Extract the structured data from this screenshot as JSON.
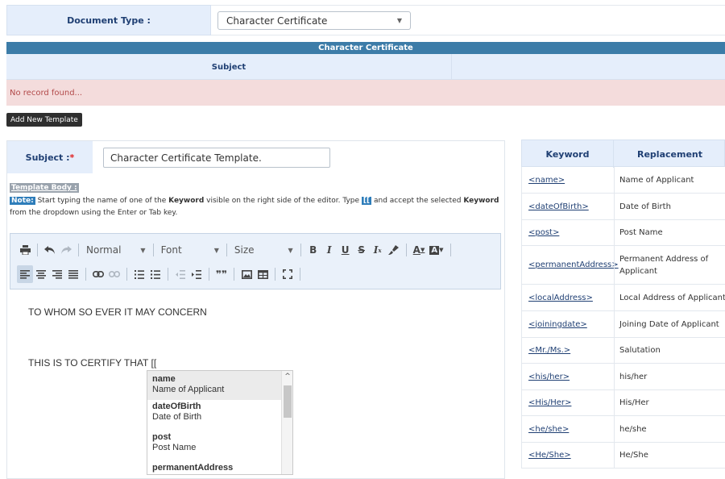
{
  "document_type": {
    "label": "Document Type :",
    "selected": "Character Certificate"
  },
  "templates_table": {
    "title": "Character Certificate",
    "column_subject": "Subject",
    "empty_message": "No record found...",
    "add_button": "Add New Template"
  },
  "editor": {
    "subject_label": "Subject :",
    "subject_required": "*",
    "subject_value": "Character Certificate Template.",
    "template_body_label": "Template Body :",
    "note_badge": "Note:",
    "note_part1": " Start typing the name of one of the ",
    "note_keyword_bold": "Keyword",
    "note_part2": " visible on the right side of the editor. Type ",
    "note_bracket": "[[",
    "note_part3": " and accept the selected ",
    "note_keyword_bold2": "Keyword",
    "note_part4": " from the dropdown using the Enter or Tab key.",
    "toolbar": {
      "format": "Normal",
      "font": "Font",
      "size": "Size"
    },
    "content_line1": "TO WHOM SO EVER IT MAY CONCERN",
    "content_line2": "THIS IS TO CERTIFY THAT [[",
    "autocomplete": [
      {
        "keyword": "name",
        "description": "Name of Applicant"
      },
      {
        "keyword": "dateOfBirth",
        "description": "Date of Birth"
      },
      {
        "keyword": "post",
        "description": "Post Name"
      },
      {
        "keyword": "permanentAddress",
        "description": ""
      }
    ]
  },
  "keyword_table": {
    "col_keyword": "Keyword",
    "col_replacement": "Replacement",
    "rows": [
      {
        "keyword": "<name>",
        "replacement": "Name of Applicant"
      },
      {
        "keyword": "<dateOfBirth>",
        "replacement": "Date of Birth"
      },
      {
        "keyword": "<post>",
        "replacement": "Post Name"
      },
      {
        "keyword": "<permanentAddress>",
        "replacement": "Permanent Address of Applicant"
      },
      {
        "keyword": "<localAddress>",
        "replacement": "Local Address of Applicant"
      },
      {
        "keyword": "<joiningdate>",
        "replacement": "Joining Date of Applicant"
      },
      {
        "keyword": "<Mr./Ms.>",
        "replacement": "Salutation"
      },
      {
        "keyword": "<his/her>",
        "replacement": "his/her"
      },
      {
        "keyword": "<His/Her>",
        "replacement": "His/Her"
      },
      {
        "keyword": "<he/she>",
        "replacement": "he/she"
      },
      {
        "keyword": "<He/She>",
        "replacement": "He/She"
      }
    ]
  }
}
